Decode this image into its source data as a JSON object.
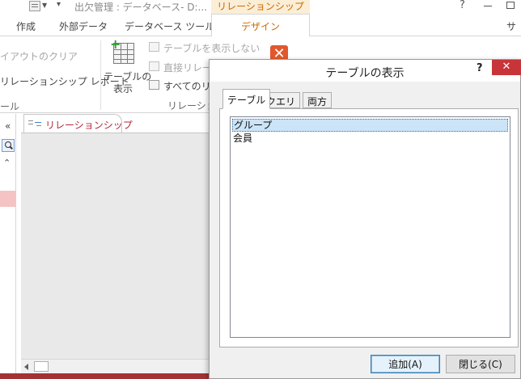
{
  "titlebar": {
    "document_title": "出欠管理 : データベース- D:...",
    "context_title": "リレーションシップ ツール",
    "help": "?",
    "icons": {
      "qat": "table-icon",
      "minimize": "minimize-icon",
      "restore": "restore-icon"
    }
  },
  "ribbon_tabs": {
    "items": [
      {
        "label": "作成"
      },
      {
        "label": "外部データ"
      },
      {
        "label": "データベース ツール"
      },
      {
        "label": "デザイン",
        "active": true
      }
    ],
    "sign_in": "サイ"
  },
  "ribbon": {
    "tools_group": {
      "clear_layout": "イアウトのクリア",
      "relationship_report": "リレーションシップ レポート",
      "label": "ール"
    },
    "show_table": {
      "line1": "テーブルの",
      "line2": "表示"
    },
    "hide_table": "テーブルを表示しない",
    "direct_relationships": "直接リレーシ",
    "all_relationships": "すべてのリレ",
    "relationships_group_label": "リレーショ",
    "accent_color": "#cc6a00"
  },
  "navpane": {
    "collapse": "«",
    "expand": "«"
  },
  "document": {
    "tab_label": "リレーションシップ",
    "tab_color": "#b4283b"
  },
  "dialog": {
    "title": "テーブルの表示",
    "help": "?",
    "close": "✕",
    "tabs": [
      {
        "label": "テーブル",
        "active": true
      },
      {
        "label": "クエリ"
      },
      {
        "label": "両方"
      }
    ],
    "list": [
      {
        "label": "グループ",
        "selected": true
      },
      {
        "label": "会員"
      }
    ],
    "buttons": {
      "add": "追加(A)",
      "close": "閉じる(C)"
    }
  }
}
